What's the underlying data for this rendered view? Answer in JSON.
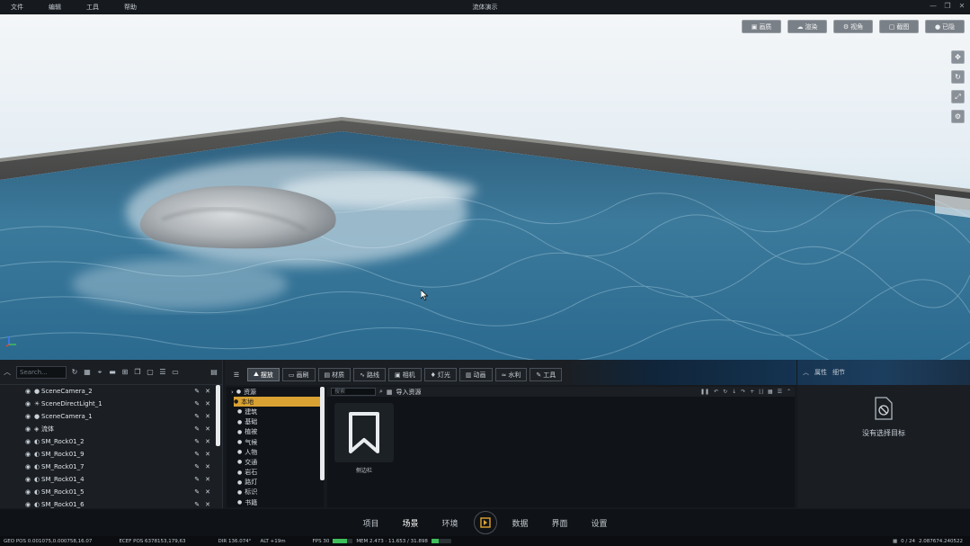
{
  "menu": [
    "文件",
    "编辑",
    "工具",
    "帮助"
  ],
  "window_title": "流体演示",
  "viewport": {
    "toolbar": [
      {
        "icon": "image-icon",
        "glyph": "▣",
        "label": "画质"
      },
      {
        "icon": "cloud-icon",
        "glyph": "☁",
        "label": "渲染"
      },
      {
        "icon": "gear-icon",
        "glyph": "⚙",
        "label": "视角"
      },
      {
        "icon": "screen-icon",
        "glyph": "▢",
        "label": "截图"
      },
      {
        "icon": "toggle-icon",
        "glyph": "●",
        "label": "已隐"
      }
    ],
    "side_tools": [
      {
        "icon": "move-icon",
        "glyph": "✥"
      },
      {
        "icon": "rotate-icon",
        "glyph": "↻"
      },
      {
        "icon": "scale-icon",
        "glyph": "⤢"
      },
      {
        "icon": "settings-icon",
        "glyph": "⚙"
      }
    ]
  },
  "outliner": {
    "search_placeholder": "Search...",
    "rows": [
      {
        "name": "SceneCamera_2",
        "type": "camera"
      },
      {
        "name": "SceneDirectLight_1",
        "type": "light"
      },
      {
        "name": "SceneCamera_1",
        "type": "camera"
      },
      {
        "name": "流体",
        "type": "fluid"
      },
      {
        "name": "SM_Rock01_2",
        "type": "mesh"
      },
      {
        "name": "SM_Rock01_9",
        "type": "mesh"
      },
      {
        "name": "SM_Rock01_7",
        "type": "mesh"
      },
      {
        "name": "SM_Rock01_4",
        "type": "mesh"
      },
      {
        "name": "SM_Rock01_5",
        "type": "mesh"
      },
      {
        "name": "SM_Rock01_6",
        "type": "mesh"
      }
    ]
  },
  "assets": {
    "tabs": [
      {
        "glyph": "⛰",
        "label": "摆放",
        "active": true
      },
      {
        "glyph": "▭",
        "label": "画刷",
        "active": false
      },
      {
        "glyph": "▤",
        "label": "材质",
        "active": false
      },
      {
        "glyph": "∿",
        "label": "路线",
        "active": false
      },
      {
        "glyph": "▣",
        "label": "相机",
        "active": false
      },
      {
        "glyph": "♦",
        "label": "灯光",
        "active": false
      },
      {
        "glyph": "▥",
        "label": "动画",
        "active": false
      },
      {
        "glyph": "≈",
        "label": "水利",
        "active": false
      },
      {
        "glyph": "✎",
        "label": "工具",
        "active": false
      }
    ],
    "categories": [
      {
        "label": "资源",
        "selected": false,
        "expander": "›"
      },
      {
        "label": "本地",
        "selected": true,
        "expander": ""
      },
      {
        "label": "建筑",
        "selected": false,
        "expander": ""
      },
      {
        "label": "基础",
        "selected": false,
        "expander": ""
      },
      {
        "label": "植被",
        "selected": false,
        "expander": ""
      },
      {
        "label": "气候",
        "selected": false,
        "expander": ""
      },
      {
        "label": "人物",
        "selected": false,
        "expander": ""
      },
      {
        "label": "交通",
        "selected": false,
        "expander": ""
      },
      {
        "label": "岩石",
        "selected": false,
        "expander": ""
      },
      {
        "label": "路灯",
        "selected": false,
        "expander": ""
      },
      {
        "label": "标识",
        "selected": false,
        "expander": ""
      },
      {
        "label": "书籍",
        "selected": false,
        "expander": ""
      }
    ],
    "search_placeholder": "搜索",
    "import_label": "导入资源",
    "items": [
      {
        "label": "侧边栏",
        "icon": "bookmark-icon"
      }
    ]
  },
  "properties": {
    "tabs": [
      "属性",
      "细节"
    ],
    "empty_message": "没有选择目标"
  },
  "nav": [
    {
      "label": "项目",
      "active": false
    },
    {
      "label": "场景",
      "active": true
    },
    {
      "label": "环境",
      "active": false
    },
    {
      "label": "数据",
      "active": false
    },
    {
      "label": "界面",
      "active": false
    },
    {
      "label": "设置",
      "active": false
    }
  ],
  "status": {
    "geo_pos": "GEO POS  0.001075,0.000758,16.07",
    "ecef_pos": "ECEF POS  6378153,179,63",
    "dir": "DIR  136.074°",
    "alt": "ALT  +19m",
    "fps": "FPS  30",
    "fps_level": 0.7,
    "mem": "MEM  2.473 · 11.653 / 31.898",
    "mem_level": 0.35,
    "right": "0 / 24",
    "time": "2.087674.240522"
  }
}
